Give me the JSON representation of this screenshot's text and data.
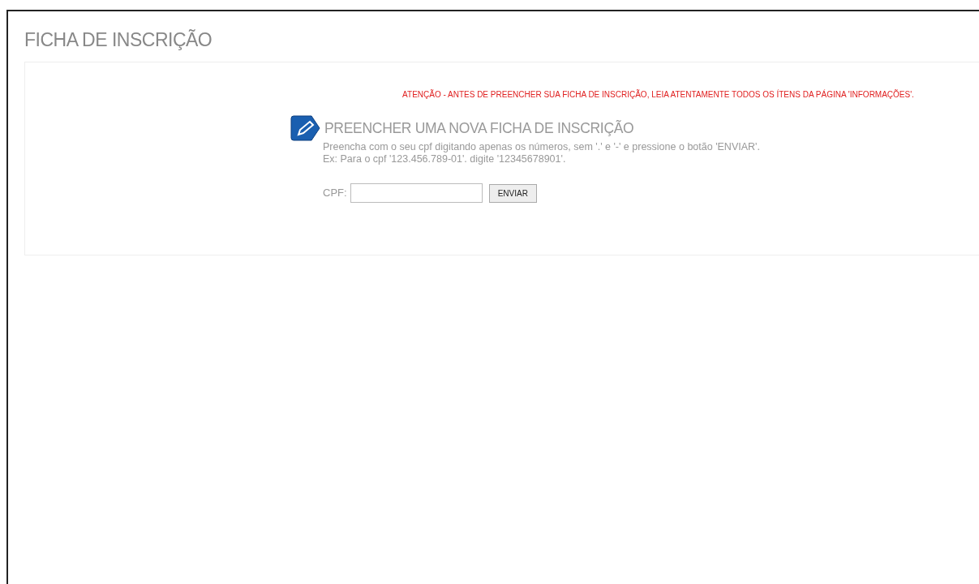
{
  "page_title": "FICHA DE INSCRIÇÃO",
  "warning": "ATENÇÃO - ANTES DE PREENCHER SUA FICHA DE INSCRIÇÃO, LEIA ATENTAMENTE TODOS OS ÍTENS DA PÁGINA 'INFORMAÇÕES'.",
  "section": {
    "heading": "PREENCHER UMA NOVA FICHA DE INSCRIÇÃO",
    "instructions": [
      "Preencha com o seu cpf digitando apenas os números, sem '.' e '-' e pressione o botão 'ENVIAR'.",
      "Ex: Para o cpf '123.456.789-01'. digite '12345678901'."
    ],
    "field": {
      "label": "CPF:"
    },
    "button": "ENVIAR"
  }
}
